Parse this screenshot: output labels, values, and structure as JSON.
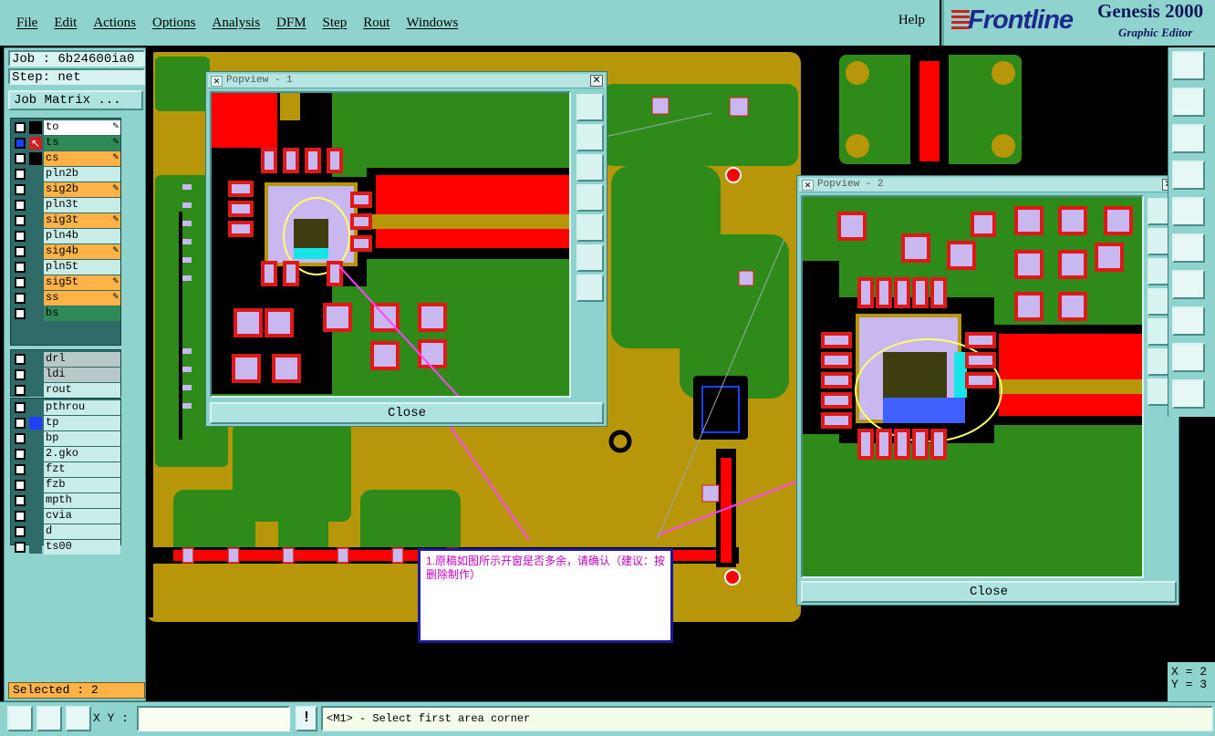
{
  "menu": {
    "items": [
      "File",
      "Edit",
      "Actions",
      "Options",
      "Analysis",
      "DFM",
      "Step",
      "Rout",
      "Windows"
    ],
    "help": "Help"
  },
  "brand": {
    "logo": "Frontline",
    "product": "Genesis 2000",
    "subtitle": "Graphic Editor"
  },
  "job": {
    "job_label": "Job : 6b24600ia0",
    "step_label": "Step: net",
    "matrix_button": "Job Matrix ..."
  },
  "layers": {
    "group1": [
      {
        "name": "to",
        "color": "#ffffff",
        "editable": true,
        "checked": false,
        "swatch": "#000000"
      },
      {
        "name": "ts",
        "color": "#2e8b57",
        "editable": true,
        "checked": true,
        "swatch": "#d01f1f",
        "active": true
      },
      {
        "name": "cs",
        "color": "#ffb347",
        "editable": true,
        "checked": false,
        "swatch": "#000000"
      },
      {
        "name": "pln2b",
        "color": "#c8ede9",
        "editable": false,
        "checked": false,
        "swatch": "#2e6b69"
      },
      {
        "name": "sig2b",
        "color": "#ffb347",
        "editable": true,
        "checked": false,
        "swatch": "#2e6b69"
      },
      {
        "name": "pln3t",
        "color": "#c8ede9",
        "editable": false,
        "checked": false,
        "swatch": "#2e6b69"
      },
      {
        "name": "sig3t",
        "color": "#ffb347",
        "editable": true,
        "checked": false,
        "swatch": "#2e6b69"
      },
      {
        "name": "pln4b",
        "color": "#c8ede9",
        "editable": false,
        "checked": false,
        "swatch": "#2e6b69"
      },
      {
        "name": "sig4b",
        "color": "#ffb347",
        "editable": true,
        "checked": false,
        "swatch": "#2e6b69"
      },
      {
        "name": "pln5t",
        "color": "#c8ede9",
        "editable": false,
        "checked": false,
        "swatch": "#2e6b69"
      },
      {
        "name": "sig5t",
        "color": "#ffb347",
        "editable": true,
        "checked": false,
        "swatch": "#2e6b69"
      },
      {
        "name": "ss",
        "color": "#ffb347",
        "editable": true,
        "checked": false,
        "swatch": "#2e6b69"
      },
      {
        "name": "bs",
        "color": "#2e8b57",
        "editable": false,
        "checked": false,
        "swatch": "#2e6b69"
      }
    ],
    "group2": [
      {
        "name": "drl",
        "color": "#b8c8c8",
        "checked": false,
        "swatch": "#2e6b69"
      },
      {
        "name": "ldi",
        "color": "#b8c8c8",
        "checked": false,
        "swatch": "#2e6b69"
      },
      {
        "name": "rout",
        "color": "#c8ede9",
        "checked": false,
        "swatch": "#2e6b69"
      }
    ],
    "group3": [
      {
        "name": "pthrou",
        "color": "#c8ede9",
        "checked": false,
        "swatch": "#2e6b69"
      },
      {
        "name": "tp",
        "color": "#c8ede9",
        "checked": false,
        "swatch": "#1f3fff"
      },
      {
        "name": "bp",
        "color": "#c8ede9",
        "checked": false,
        "swatch": "#2e6b69"
      },
      {
        "name": "2.gko",
        "color": "#c8ede9",
        "checked": false,
        "swatch": "#2e6b69"
      },
      {
        "name": "fzt",
        "color": "#c8ede9",
        "checked": false,
        "swatch": "#2e6b69"
      },
      {
        "name": "fzb",
        "color": "#c8ede9",
        "checked": false,
        "swatch": "#2e6b69"
      },
      {
        "name": "mpth",
        "color": "#c8ede9",
        "checked": false,
        "swatch": "#2e6b69"
      },
      {
        "name": "cvia",
        "color": "#c8ede9",
        "checked": false,
        "swatch": "#2e6b69"
      },
      {
        "name": "d",
        "color": "#c8ede9",
        "checked": false,
        "swatch": "#2e6b69"
      },
      {
        "name": "ts00",
        "color": "#c8ede9",
        "checked": false,
        "swatch": "#2e6b69"
      }
    ]
  },
  "selected_label": "Selected : 2",
  "popup1": {
    "title": "Popview - 1",
    "close_label": "Close"
  },
  "popup2": {
    "title": "Popview - 2",
    "close_label": "Close"
  },
  "note": {
    "text": "1.原稿如图所示开窗是否多余，请确认（建议：按删除制作）"
  },
  "coords": {
    "x_label": "X = 2",
    "y_label": "Y = 3"
  },
  "bottom": {
    "xy_label": "X Y :",
    "xy_value": "",
    "bang_label": "!",
    "status": "<M1> - Select first area corner"
  },
  "colors": {
    "board": "#b8960a",
    "copper": "#2e8b1a",
    "pad": "#c9b8f0",
    "pad_outline": "#e01818",
    "trace": "#ff0000",
    "panel": "#8fd3cf",
    "highlight": "#ffff66",
    "marker": "#ff44ff"
  }
}
